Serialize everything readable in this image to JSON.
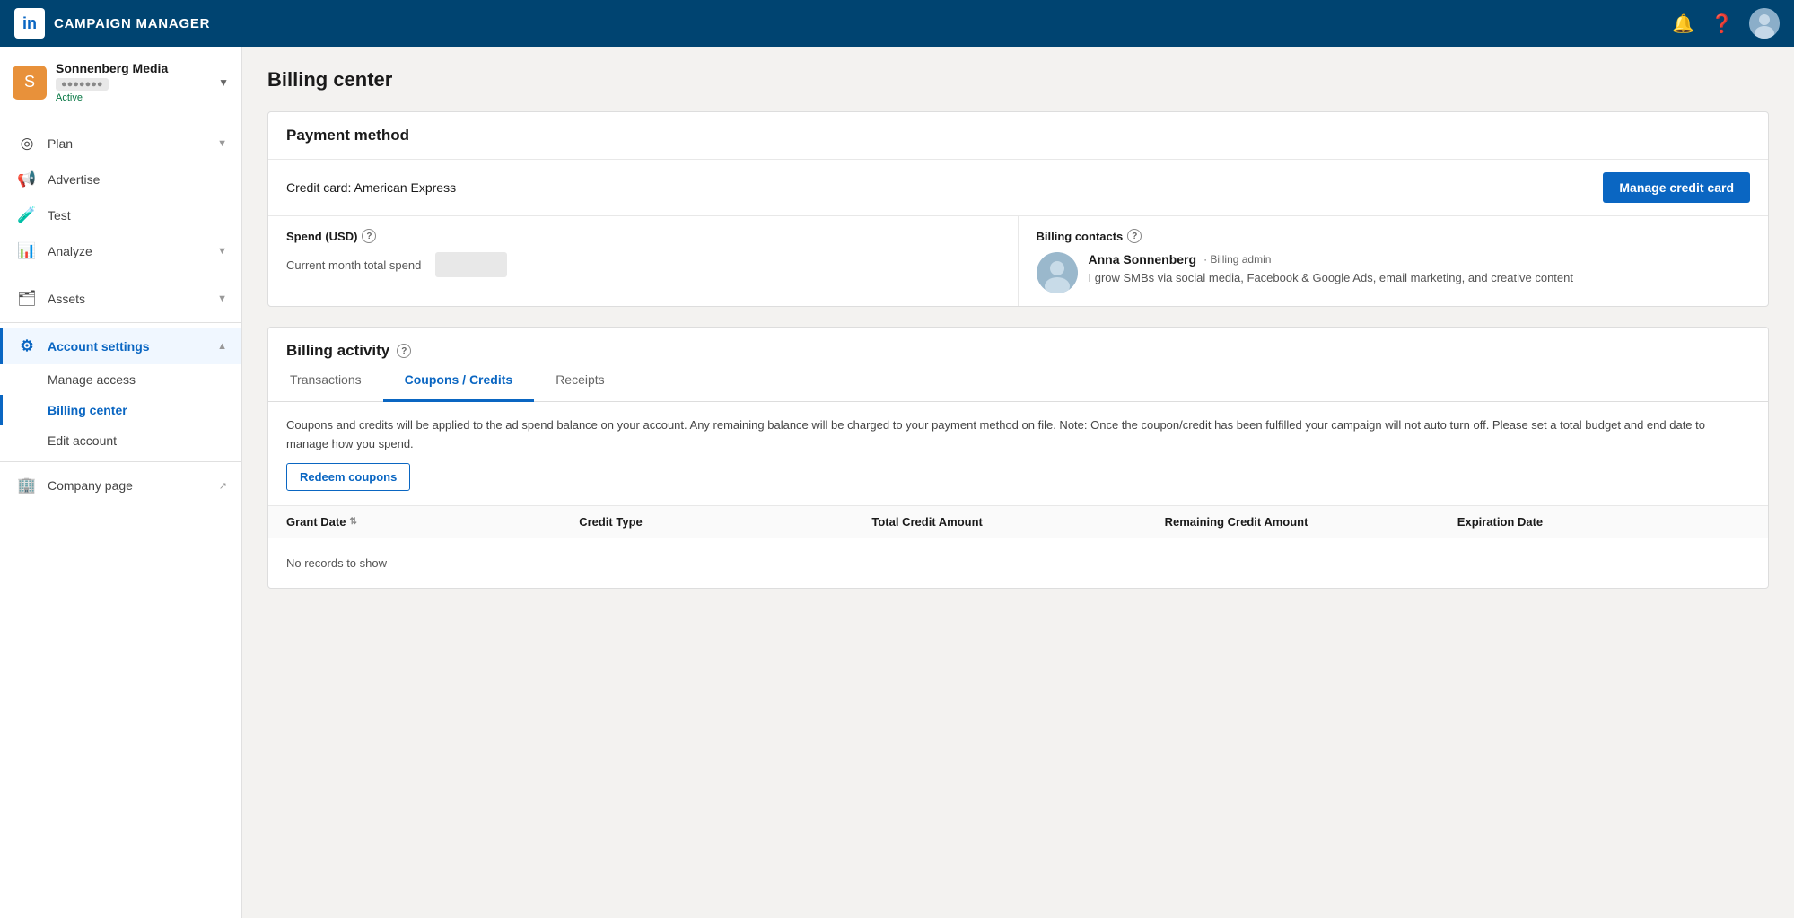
{
  "topnav": {
    "logo_text": "in",
    "title": "CAMPAIGN MANAGER"
  },
  "sidebar": {
    "account": {
      "name": "Sonnenberg Media",
      "id_placeholder": "●●●●●●●",
      "status": "Active"
    },
    "nav_items": [
      {
        "id": "plan",
        "label": "Plan",
        "icon": "◎",
        "has_chevron": true
      },
      {
        "id": "advertise",
        "label": "Advertise",
        "icon": "📢",
        "has_chevron": false
      },
      {
        "id": "test",
        "label": "Test",
        "icon": "🧪",
        "has_chevron": false
      },
      {
        "id": "analyze",
        "label": "Analyze",
        "icon": "📊",
        "has_chevron": true
      }
    ],
    "assets": {
      "label": "Assets",
      "icon": "🗂",
      "has_chevron": true
    },
    "account_settings": {
      "label": "Account settings",
      "icon": "⚙",
      "is_active": true,
      "subitems": [
        {
          "id": "manage-access",
          "label": "Manage access"
        },
        {
          "id": "billing-center",
          "label": "Billing center",
          "is_active": true
        },
        {
          "id": "edit-account",
          "label": "Edit account"
        }
      ]
    },
    "company_page": {
      "label": "Company page",
      "icon": "🏢",
      "has_external": true
    }
  },
  "main": {
    "page_title": "Billing center",
    "payment_method": {
      "section_title": "Payment method",
      "credit_card_label": "Credit card: American Express",
      "manage_btn_label": "Manage credit card",
      "spend_label": "Spend (USD)",
      "current_month_label": "Current month total spend",
      "billing_contacts_label": "Billing contacts",
      "contact": {
        "name": "Anna Sonnenberg",
        "role": "Billing admin",
        "bio": "I grow SMBs via social media, Facebook & Google Ads, email marketing, and creative content"
      }
    },
    "billing_activity": {
      "section_title": "Billing activity",
      "tabs": [
        {
          "id": "transactions",
          "label": "Transactions",
          "is_active": false
        },
        {
          "id": "coupons-credits",
          "label": "Coupons / Credits",
          "is_active": true
        },
        {
          "id": "receipts",
          "label": "Receipts",
          "is_active": false
        }
      ],
      "coupons_description": "Coupons and credits will be applied to the ad spend balance on your account. Any remaining balance will be charged to your payment method on file. Note: Once the coupon/credit has been fulfilled your campaign will not auto turn off. Please set a total budget and end date to manage how you spend.",
      "redeem_btn_label": "Redeem coupons",
      "table_headers": [
        {
          "label": "Grant Date",
          "sortable": true
        },
        {
          "label": "Credit Type",
          "sortable": false
        },
        {
          "label": "Total Credit Amount",
          "sortable": false
        },
        {
          "label": "Remaining Credit Amount",
          "sortable": false
        },
        {
          "label": "Expiration Date",
          "sortable": false
        }
      ],
      "empty_message": "No records to show"
    }
  }
}
